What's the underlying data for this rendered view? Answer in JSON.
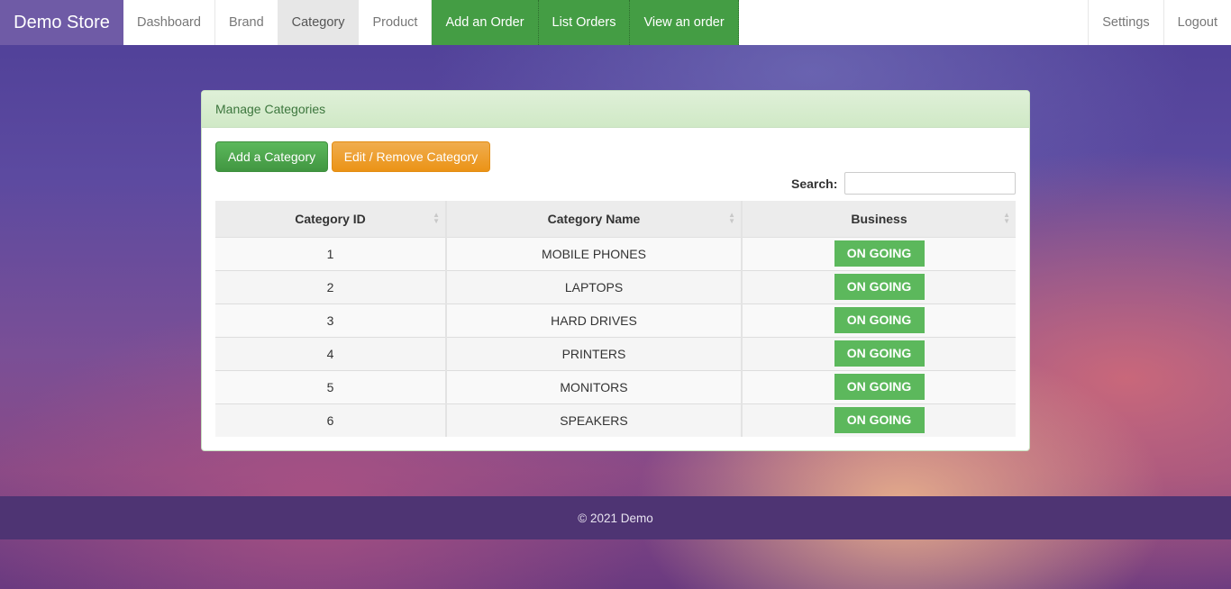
{
  "nav": {
    "brand": "Demo Store",
    "items": [
      {
        "label": "Dashboard"
      },
      {
        "label": "Brand"
      },
      {
        "label": "Category"
      },
      {
        "label": "Product"
      },
      {
        "label": "Add an Order"
      },
      {
        "label": "List Orders"
      },
      {
        "label": "View an order"
      }
    ],
    "right": [
      {
        "label": "Settings"
      },
      {
        "label": "Logout"
      }
    ]
  },
  "panel": {
    "title": "Manage Categories",
    "add_button": "Add a Category",
    "edit_button": "Edit / Remove Category",
    "search_label": "Search:",
    "search_value": ""
  },
  "table": {
    "headers": [
      "Category ID",
      "Category Name",
      "Business"
    ],
    "rows": [
      {
        "id": "1",
        "name": "MOBILE PHONES",
        "status": "ON GOING"
      },
      {
        "id": "2",
        "name": "LAPTOPS",
        "status": "ON GOING"
      },
      {
        "id": "3",
        "name": "HARD DRIVES",
        "status": "ON GOING"
      },
      {
        "id": "4",
        "name": "PRINTERS",
        "status": "ON GOING"
      },
      {
        "id": "5",
        "name": "MONITORS",
        "status": "ON GOING"
      },
      {
        "id": "6",
        "name": "SPEAKERS",
        "status": "ON GOING"
      }
    ]
  },
  "footer": {
    "text": "© 2021 Demo"
  },
  "colors": {
    "status_ongoing": "#5cb85c",
    "nav_green": "#449d44",
    "brand_bg": "#6f5ba6"
  }
}
